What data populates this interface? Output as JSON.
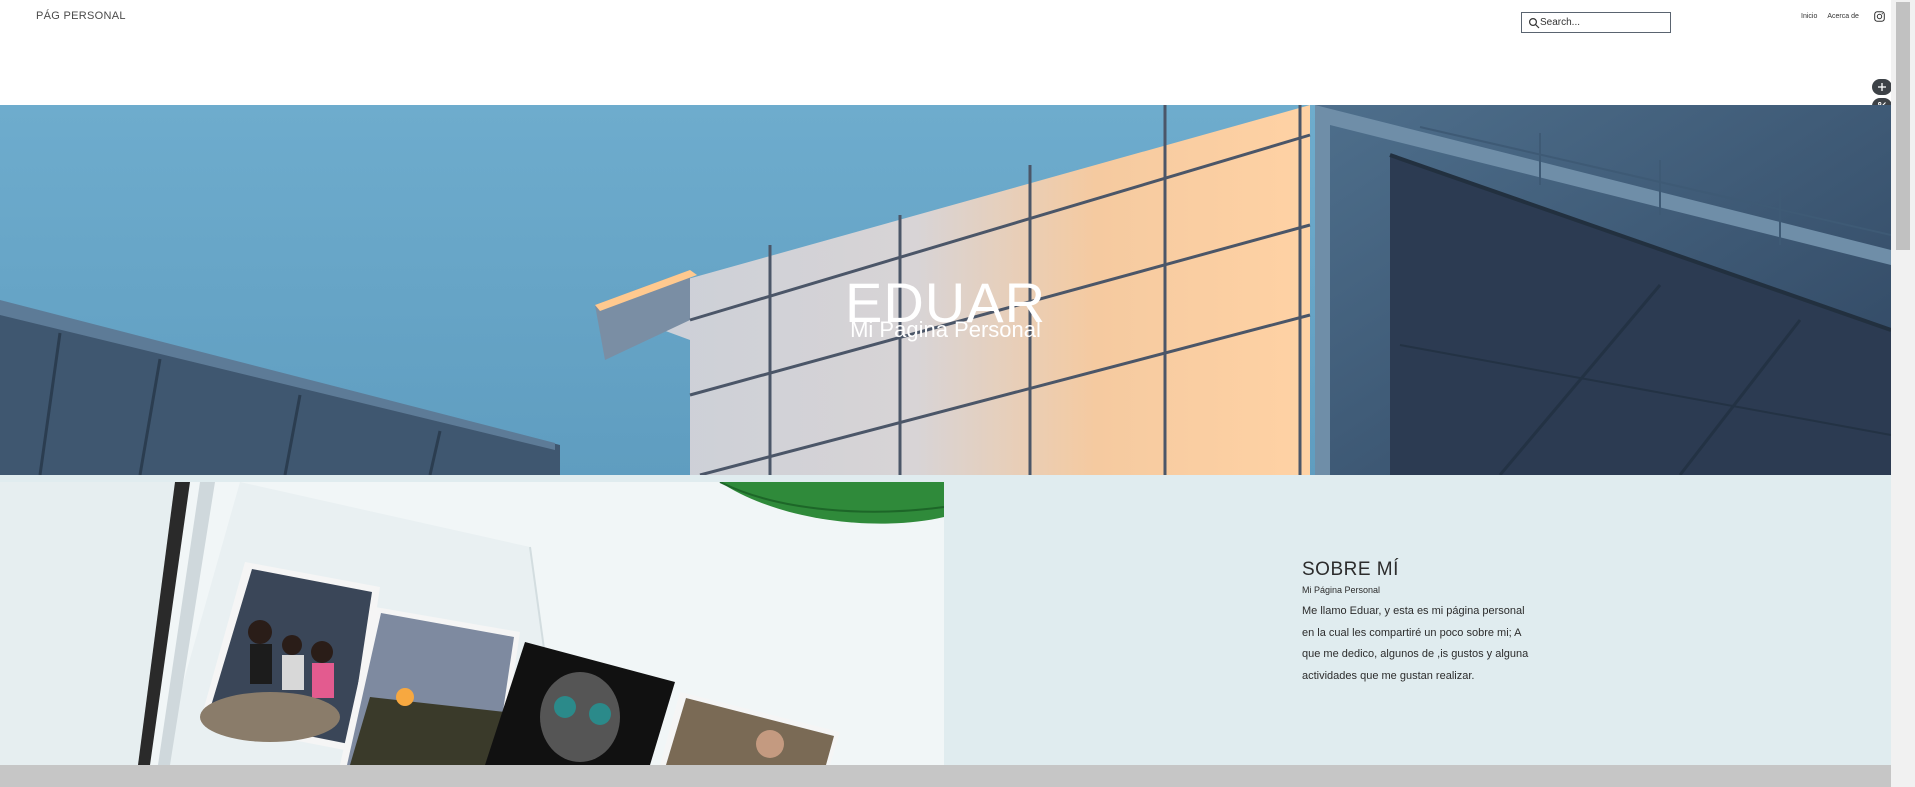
{
  "header": {
    "site_title": "PÁG PERSONAL",
    "search": {
      "placeholder": "Search..."
    },
    "nav": [
      {
        "label": "Inicio"
      },
      {
        "label": "Acerca de"
      }
    ]
  },
  "hero": {
    "title": "EDUAR",
    "subtitle": "Mi Pagina Personal"
  },
  "about": {
    "title": "SOBRE MÍ",
    "subtitle": "Mi Página Personal",
    "body": "Me llamo Eduar,  y esta es mi página personal en la cual les compartiré un poco sobre mi; A que me dedico, algunos de ,is gustos y alguna actividades que me gustan realizar."
  },
  "colors": {
    "sky": "#65a4c6",
    "about_bg": "#e0ecef",
    "text": "#2c2c2c"
  },
  "icons": [
    "search-icon",
    "instagram-icon",
    "plus-icon",
    "percent-icon"
  ]
}
